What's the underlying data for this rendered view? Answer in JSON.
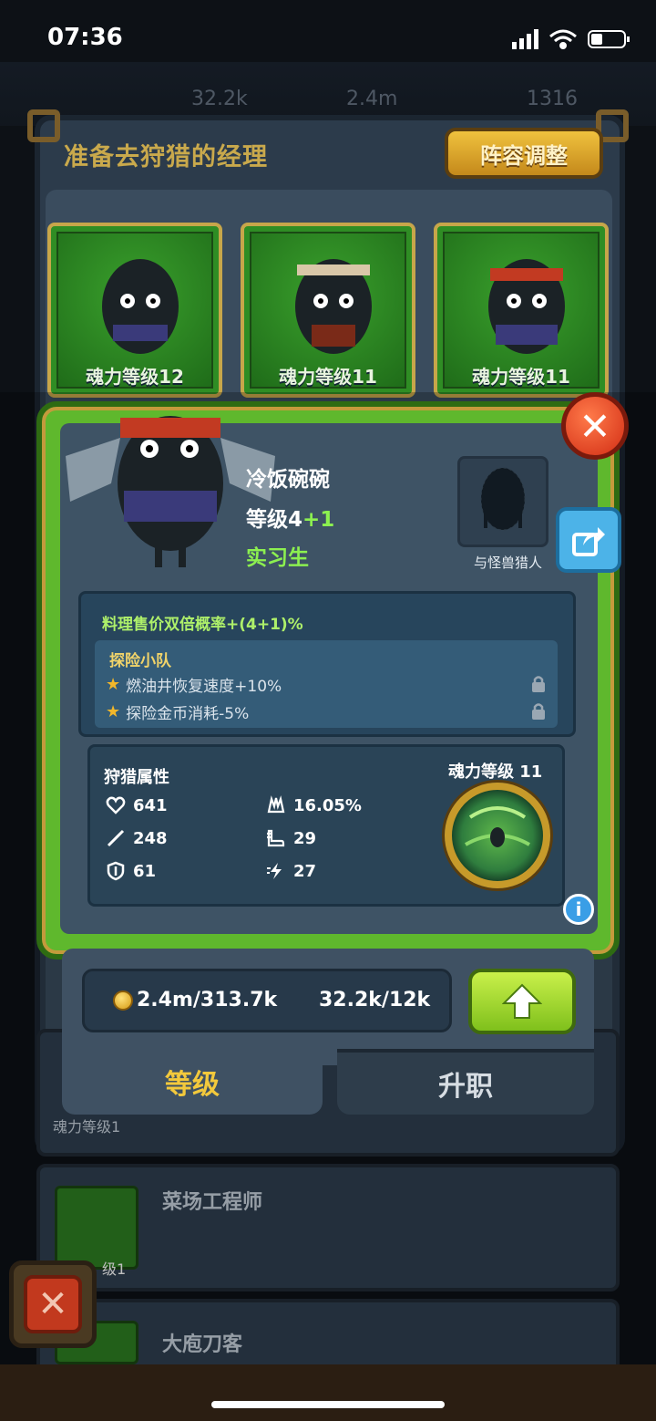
{
  "status_bar": {
    "time": "07:36"
  },
  "background_hud": {
    "values": [
      "32.2k",
      "2.4m",
      "1316"
    ]
  },
  "header": {
    "title": "准备去狩猎的经理",
    "lineup_button": "阵容调整"
  },
  "team_cards": [
    {
      "label": "魂力等级12"
    },
    {
      "label": "魂力等级11"
    },
    {
      "label": "魂力等级11"
    }
  ],
  "popup": {
    "name": "冷饭碗碗",
    "level_prefix": "等级4",
    "level_bonus": "+1",
    "rank": "实习生",
    "partner_label": "与怪兽猎人",
    "main_skill": "料理售价双倍概率+(4+1)%",
    "squad": {
      "title": "探险小队",
      "lines": [
        "燃油井恢复速度+10%",
        "探险金币消耗-5%"
      ]
    },
    "attributes": {
      "title": "狩猎属性",
      "health": "641",
      "attack": "248",
      "defense": "61",
      "crit": "16.05%",
      "speed": "29",
      "energy": "27"
    },
    "soul_level": "魂力等级 11",
    "cost_gold": "2.4m/313.7k",
    "cost_soul": "32.2k/12k",
    "tabs": {
      "level": "等级",
      "promote": "升职"
    }
  },
  "list_rows": [
    {
      "title": "菜场工程师",
      "thumb_label": "级1"
    },
    {
      "title": "大庖刀客"
    }
  ],
  "behind_label": "魂力等级1",
  "colors": {
    "accent_green": "#8cf050",
    "gold": "#f3c93c",
    "close_red": "#d22d14"
  }
}
